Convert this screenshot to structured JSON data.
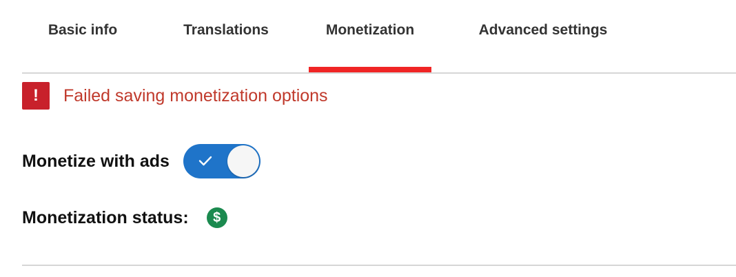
{
  "tabs": [
    {
      "label": "Basic info",
      "selected": false
    },
    {
      "label": "Translations",
      "selected": false
    },
    {
      "label": "Monetization",
      "selected": true
    },
    {
      "label": "Advanced settings",
      "selected": false
    }
  ],
  "error": {
    "icon": "exclamation-icon",
    "icon_glyph": "!",
    "message": "Failed saving monetization options"
  },
  "monetize_with_ads": {
    "label": "Monetize with ads",
    "enabled": true
  },
  "monetization_status": {
    "label": "Monetization status:",
    "icon": "dollar-icon",
    "icon_glyph": "$"
  },
  "colors": {
    "accent_red": "#f02525",
    "error_red": "#c8212b",
    "toggle_blue": "#1f74c9",
    "status_green": "#1b8a4f"
  }
}
